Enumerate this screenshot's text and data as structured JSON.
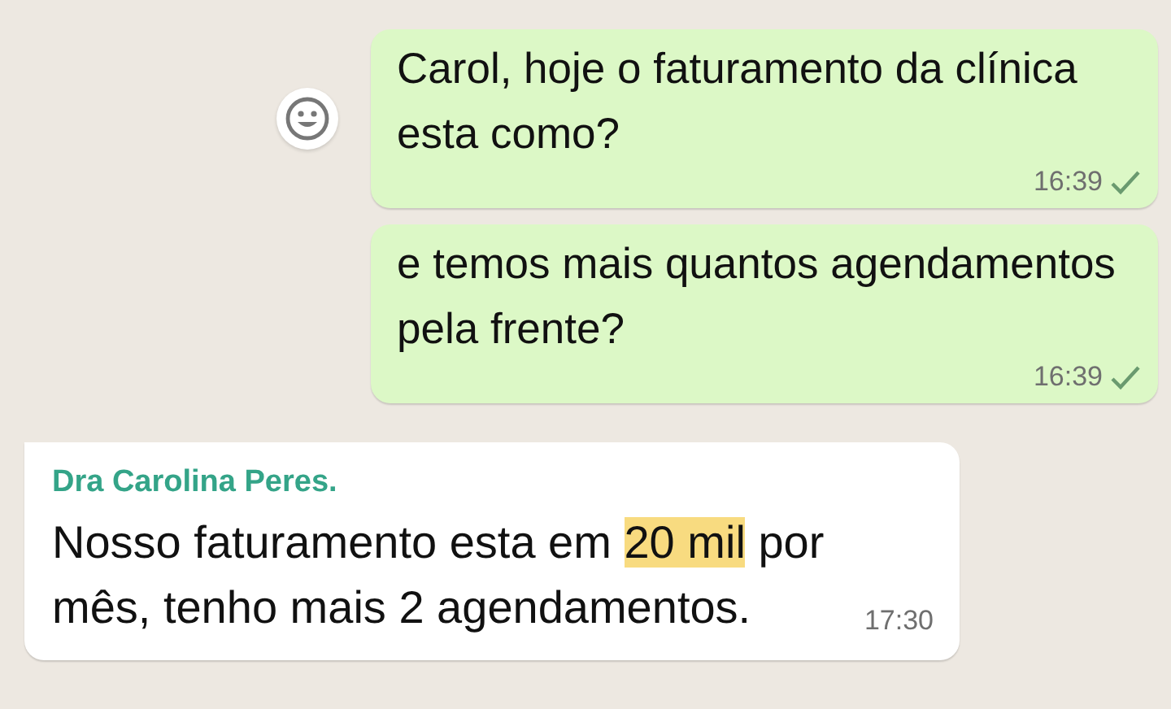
{
  "messages": [
    {
      "kind": "sent",
      "text": "Carol, hoje o faturamento da clínica\nesta como?",
      "time": "16:39",
      "checked": true,
      "emoji_button": true
    },
    {
      "kind": "sent",
      "text": "e temos mais quantos agendamentos\npela frente?",
      "time": "16:39",
      "checked": true,
      "emoji_button": false
    },
    {
      "kind": "received",
      "sender": "Dra Carolina Peres.",
      "text_before": "Nosso faturamento esta em ",
      "highlight": "20 mil",
      "text_after": " por\nmês, tenho mais 2 agendamentos.",
      "time": "17:30"
    }
  ]
}
